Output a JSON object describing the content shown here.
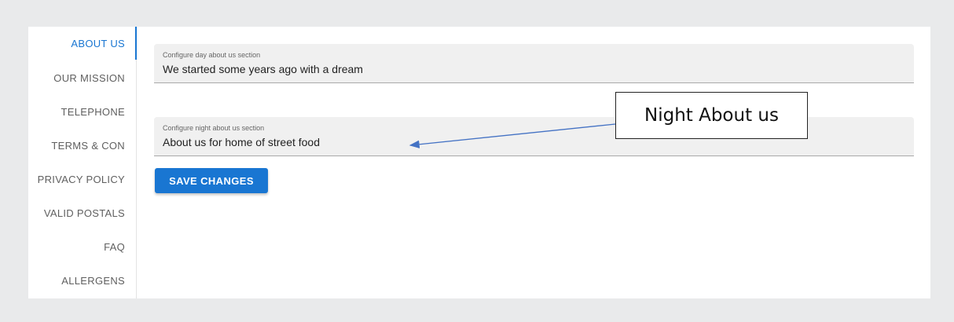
{
  "sidebar": {
    "items": [
      {
        "label": "ABOUT US",
        "active": true
      },
      {
        "label": "OUR MISSION"
      },
      {
        "label": "TELEPHONE"
      },
      {
        "label": "TERMS & CON"
      },
      {
        "label": "PRIVACY POLICY"
      },
      {
        "label": "VALID POSTALS"
      },
      {
        "label": "FAQ"
      },
      {
        "label": "ALLERGENS"
      }
    ]
  },
  "form": {
    "day_about": {
      "label": "Configure day about us section",
      "value": "We started some years ago with a dream"
    },
    "night_about": {
      "label": "Configure night about us section",
      "value": "About us for home of street food"
    },
    "save_label": "SAVE CHANGES"
  },
  "annotation": {
    "callout_text": "Night About us"
  },
  "colors": {
    "accent": "#1976d2",
    "background": "#e9eaeb",
    "field_bg": "#f0f0f0",
    "annotation_arrow": "#4472c4"
  }
}
